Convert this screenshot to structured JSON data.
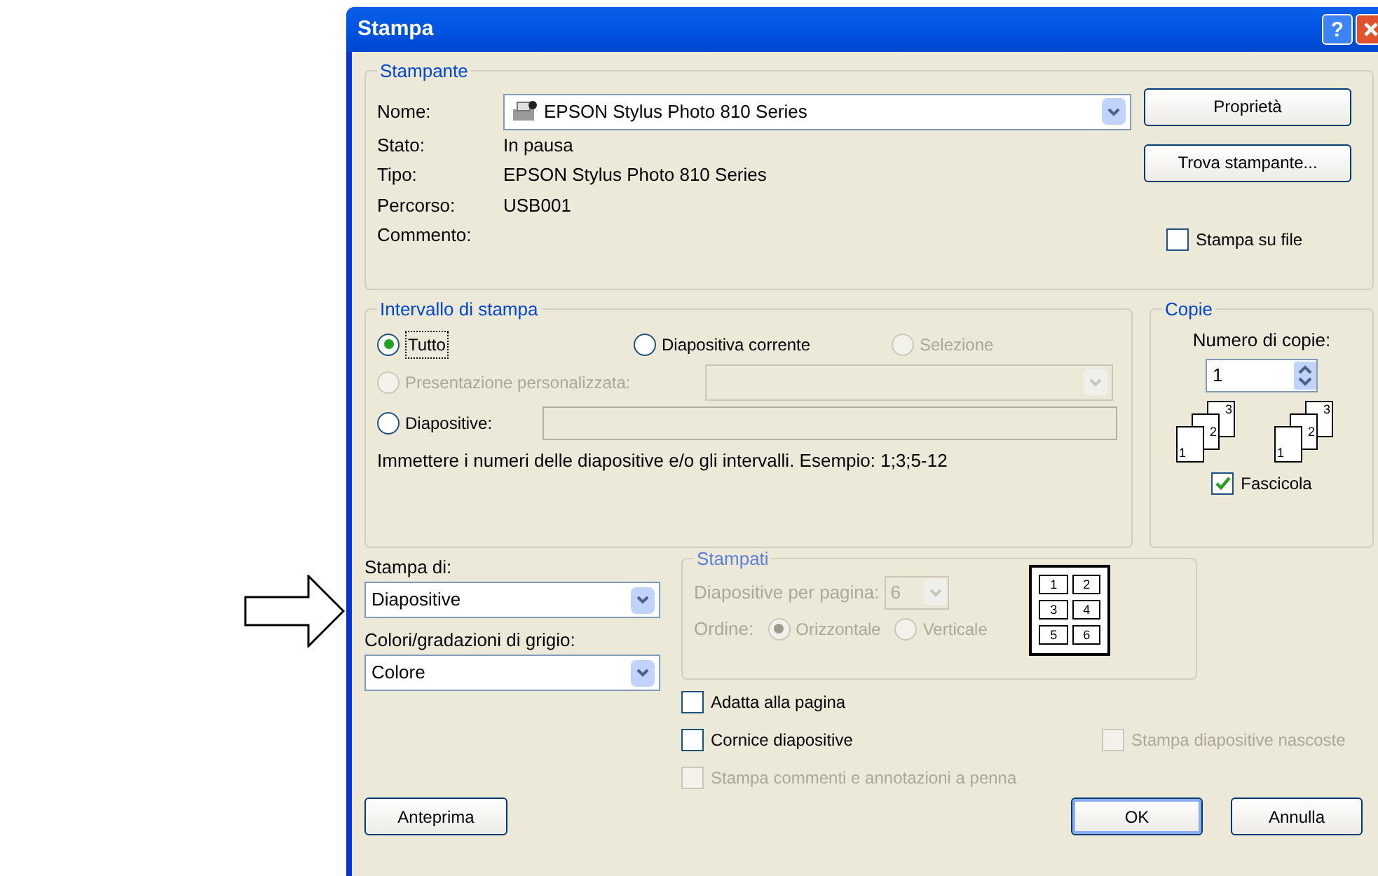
{
  "window": {
    "title": "Stampa",
    "help": "?"
  },
  "printer": {
    "group": "Stampante",
    "name_label": "Nome:",
    "name_value": "EPSON Stylus Photo 810 Series",
    "info": [
      {
        "label": "Stato:",
        "value": "In pausa"
      },
      {
        "label": "Tipo:",
        "value": "EPSON Stylus Photo 810 Series"
      },
      {
        "label": "Percorso:",
        "value": "USB001"
      },
      {
        "label": "Commento:"
      }
    ],
    "buttons": [
      "Proprietà",
      "Trova stampante..."
    ],
    "print_to_file": {
      "label": "Stampa su file",
      "checked": false
    }
  },
  "range": {
    "group": "Intervallo di stampa",
    "options": [
      {
        "label": "Tutto",
        "selected": true,
        "disabled": false
      },
      {
        "label": "Diapositiva corrente",
        "selected": false,
        "disabled": false
      },
      {
        "label": "Selezione",
        "selected": false,
        "disabled": true
      },
      {
        "label": "Presentazione personalizzata:",
        "selected": false,
        "disabled": true
      },
      {
        "label": "Diapositive:",
        "selected": false,
        "disabled": false
      }
    ],
    "hint": "Immettere i numeri delle diapositive e/o gli intervalli. Esempio: 1;3;5-12"
  },
  "copies": {
    "group": "Copie",
    "label": "Numero di copie:",
    "value": "1",
    "stacks": [
      [
        "1",
        "2",
        "3"
      ],
      [
        "1",
        "2",
        "3"
      ]
    ],
    "collate": {
      "label": "Fascicola",
      "checked": true
    }
  },
  "print_what": {
    "label": "Stampa di:",
    "value": "Diapositive"
  },
  "color_mode": {
    "label": "Colori/gradazioni di grigio:",
    "value": "Colore"
  },
  "handouts": {
    "group": "Stampati",
    "disabled": true,
    "per_page_label": "Diapositive per pagina:",
    "per_page_value": "6",
    "order_label": "Ordine:",
    "order_options": [
      {
        "label": "Orizzontale",
        "selected": true
      },
      {
        "label": "Verticale",
        "selected": false
      }
    ],
    "preview": [
      "1",
      "2",
      "3",
      "4",
      "5",
      "6"
    ]
  },
  "options": [
    {
      "label": "Adatta alla pagina",
      "checked": false,
      "disabled": false
    },
    {
      "label": "Cornice diapositive",
      "checked": false,
      "disabled": false
    },
    {
      "label": "Stampa commenti e annotazioni a penna",
      "checked": false,
      "disabled": true
    },
    {
      "label": "Stampa diapositive nascoste",
      "checked": false,
      "disabled": true
    }
  ],
  "buttons": [
    {
      "label": "Anteprima",
      "default": false
    },
    {
      "label": "OK",
      "default": true
    },
    {
      "label": "Annulla",
      "default": false
    }
  ]
}
